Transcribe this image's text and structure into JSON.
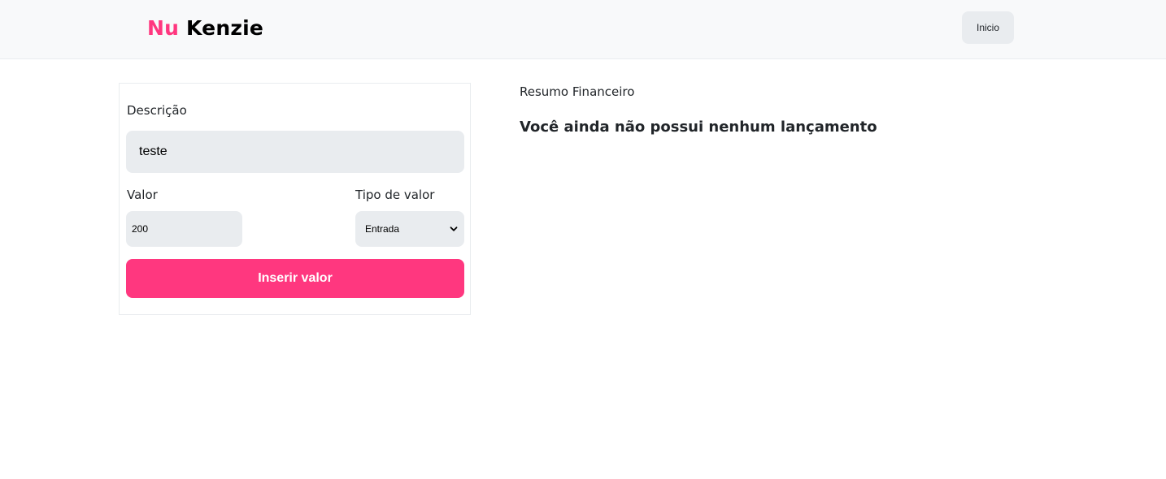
{
  "header": {
    "logo_part1": "Nu",
    "logo_part2": "Kenzie",
    "home_button": "Inicio"
  },
  "form": {
    "description_label": "Descrição",
    "description_value": "teste",
    "value_label": "Valor",
    "value_value": "200",
    "type_label": "Tipo de valor",
    "type_selected": "Entrada",
    "submit_label": "Inserir valor"
  },
  "summary": {
    "title": "Resumo Financeiro",
    "empty_message": "Você ainda não possui nenhum lançamento"
  },
  "colors": {
    "accent": "#ff377f",
    "header_bg": "#f8f9fa",
    "input_bg": "#e9ecef"
  }
}
